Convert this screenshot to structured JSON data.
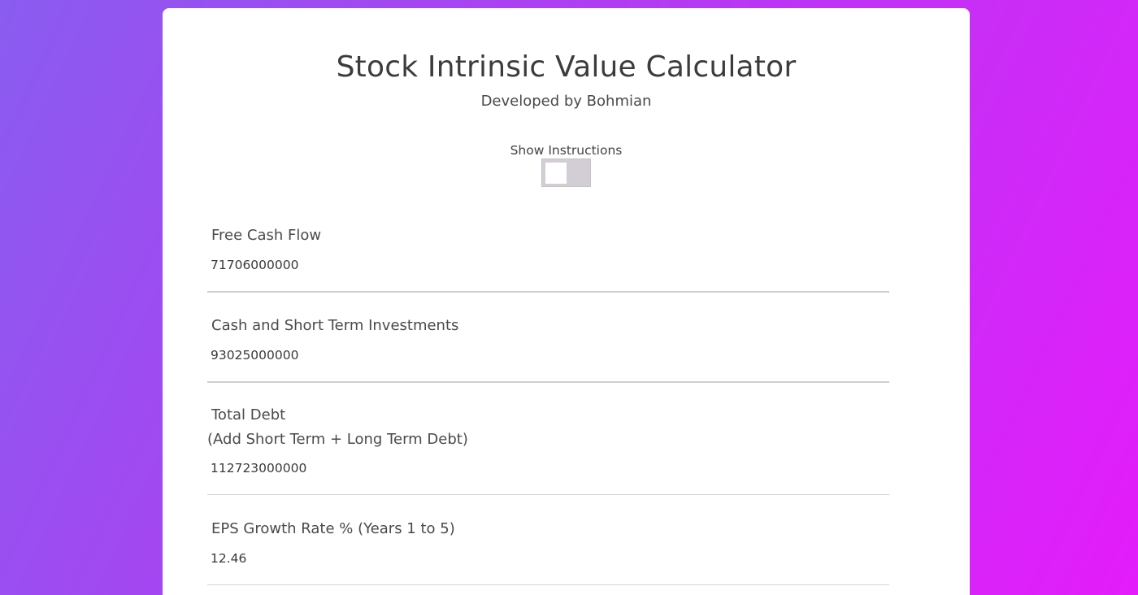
{
  "page": {
    "title": "Stock Intrinsic Value Calculator",
    "subtitle": "Developed by Bohmian"
  },
  "instructions_toggle": {
    "label": "Show Instructions",
    "checked": false
  },
  "fields": [
    {
      "label": "Free Cash Flow",
      "value": "71706000000"
    },
    {
      "label": "Cash and Short Term Investments",
      "value": "93025000000"
    },
    {
      "label": "Total Debt",
      "sublabel": "(Add Short Term + Long Term Debt)",
      "value": "112723000000"
    },
    {
      "label": "EPS Growth Rate % (Years 1 to 5)",
      "value": "12.46"
    }
  ],
  "colors": {
    "background_gradient_start": "#8a5cf0",
    "background_gradient_end": "#e41cfb",
    "card": "#ffffff",
    "toggle_track": "#d3ced6",
    "divider": "#cfcfcf"
  }
}
